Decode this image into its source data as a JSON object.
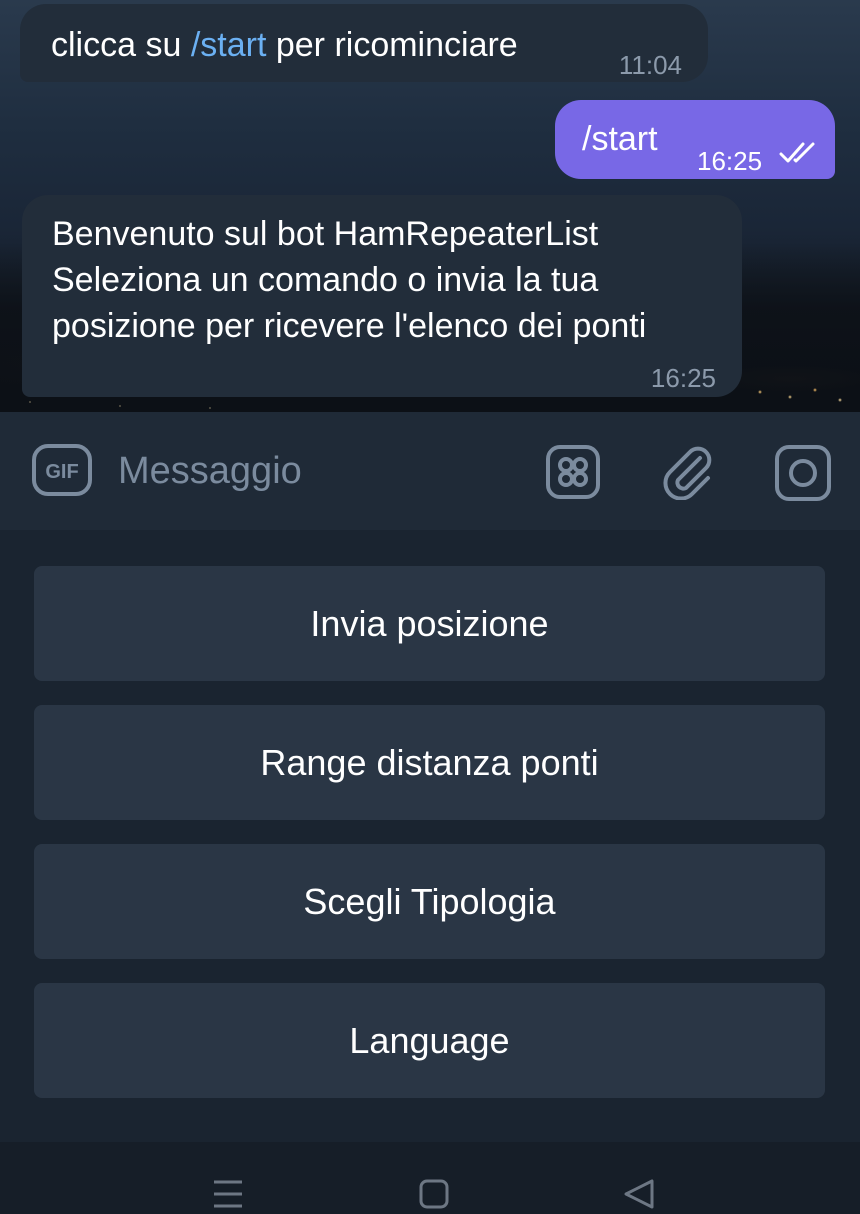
{
  "messages": [
    {
      "direction": "incoming",
      "text_before": "clicca su ",
      "link": "/start",
      "text_after": " per ricominciare",
      "time": "11:04"
    },
    {
      "direction": "outgoing",
      "text": "/start",
      "time": "16:25",
      "status_icon": "double-check-icon"
    },
    {
      "direction": "incoming",
      "lines": [
        "Benvenuto sul bot HamRepeaterList",
        "Seleziona un comando o invia la tua",
        "posizione per ricevere l'elenco dei ponti"
      ],
      "time": "16:25"
    }
  ],
  "input": {
    "placeholder": "Messaggio",
    "gif_label": "GIF",
    "icons": [
      "gif-icon",
      "sticker-icon",
      "paperclip-icon",
      "camera-icon"
    ]
  },
  "keyboard": {
    "buttons": [
      "Invia posizione",
      "Range distanza ponti",
      "Scegli Tipologia",
      "Language"
    ]
  },
  "navbar": {
    "icons": [
      "menu-icon",
      "home-icon",
      "back-icon"
    ]
  },
  "colors": {
    "outgoing_bubble": "#7868e6",
    "incoming_bubble": "#222d3a",
    "link": "#6bb0f2",
    "keyboard_button": "#2a3645",
    "background": "#1d2733"
  }
}
